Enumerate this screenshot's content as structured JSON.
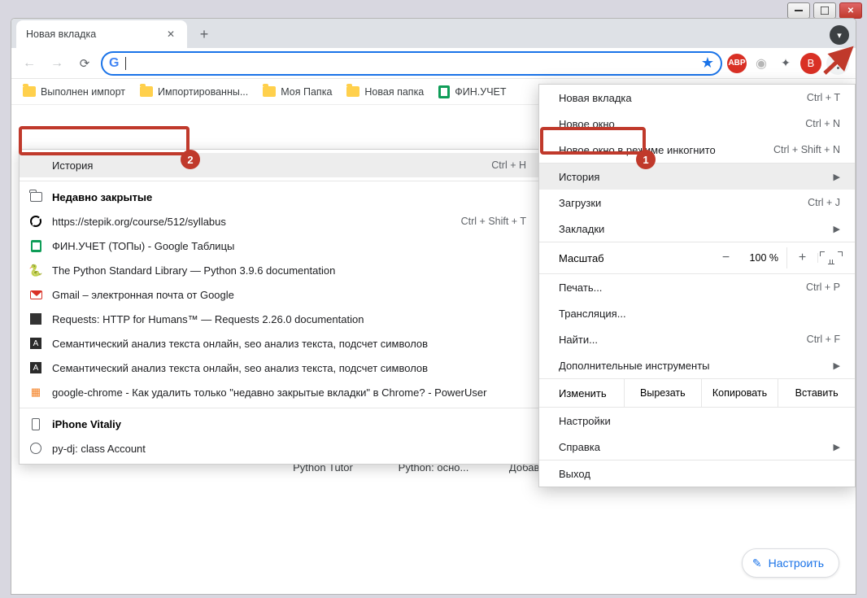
{
  "window": {
    "tab_title": "Новая вкладка"
  },
  "toolbar": {
    "avatar_letter": "В",
    "abp_label": "ABP"
  },
  "bookmarks": [
    {
      "label": "Выполнен импорт",
      "icon": "folder"
    },
    {
      "label": "Импортированны...",
      "icon": "folder"
    },
    {
      "label": "Моя Папка",
      "icon": "folder"
    },
    {
      "label": "Новая папка",
      "icon": "folder"
    },
    {
      "label": "ФИН.УЧЕТ",
      "icon": "sheets"
    }
  ],
  "main_menu": {
    "items": [
      {
        "label": "Новая вкладка",
        "shortcut": "Ctrl + T"
      },
      {
        "label": "Новое окно",
        "shortcut": "Ctrl + N"
      },
      {
        "label": "Новое окно в режиме инкогнито",
        "shortcut": "Ctrl + Shift + N"
      }
    ],
    "history_label": "История",
    "downloads": {
      "label": "Загрузки",
      "shortcut": "Ctrl + J"
    },
    "bookmarks_label": "Закладки",
    "zoom": {
      "label": "Масштаб",
      "value": "100 %",
      "minus": "−",
      "plus": "+"
    },
    "print": {
      "label": "Печать...",
      "shortcut": "Ctrl + P"
    },
    "cast_label": "Трансляция...",
    "find": {
      "label": "Найти...",
      "shortcut": "Ctrl + F"
    },
    "tools_label": "Дополнительные инструменты",
    "edit": {
      "label": "Изменить",
      "cut": "Вырезать",
      "copy": "Копировать",
      "paste": "Вставить"
    },
    "settings_label": "Настройки",
    "help_label": "Справка",
    "exit_label": "Выход"
  },
  "history_menu": {
    "history": {
      "label": "История",
      "shortcut": "Ctrl + H"
    },
    "recent_header": "Недавно закрытые",
    "reopen_shortcut": "Ctrl + Shift + T",
    "items": [
      {
        "icon": "stepik",
        "label": "https://stepik.org/course/512/syllabus"
      },
      {
        "icon": "sheets",
        "label": "ФИН.УЧЕТ (ТОПы) - Google Таблицы"
      },
      {
        "icon": "python",
        "label": "The Python Standard Library — Python 3.9.6 documentation"
      },
      {
        "icon": "gmail",
        "label": "Gmail – электронная почта от Google"
      },
      {
        "icon": "req",
        "label": "Requests: HTTP for Humans™ — Requests 2.26.0 documentation"
      },
      {
        "icon": "a",
        "label": "Семантический анализ текста онлайн, seo анализ текста, подсчет символов"
      },
      {
        "icon": "a",
        "label": "Семантический анализ текста онлайн, seo анализ текста, подсчет символов"
      },
      {
        "icon": "so",
        "label": "google-chrome - Как удалить только \"недавно закрытые вкладки\" в Chrome? - PowerUser"
      }
    ],
    "device_header": "iPhone Vitaliy",
    "device_item": "py-dj: class Account"
  },
  "ntp": {
    "items": [
      {
        "label": "Python Tutor",
        "icon": "python"
      },
      {
        "label": "Python: осно...",
        "icon": "stepik"
      },
      {
        "label": "Добавить яр...",
        "icon": "plus"
      }
    ]
  },
  "customize_label": "Настроить",
  "annotations": {
    "badge1": "1",
    "badge2": "2"
  }
}
